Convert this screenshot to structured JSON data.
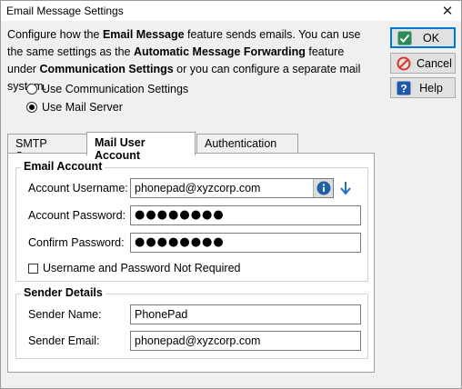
{
  "window": {
    "title": "Email Message Settings"
  },
  "intro": {
    "t1": "Configure how the ",
    "b1": "Email Message",
    "t2": " feature sends emails.  You can use the same settings as the ",
    "b2": "Automatic Message Forwarding",
    "t3": " feature under ",
    "b3": "Communication Settings",
    "t4": " or you can configure a separate mail system."
  },
  "buttons": {
    "ok": "OK",
    "cancel": "Cancel",
    "help": "Help"
  },
  "mode": {
    "options": [
      "Use Communication Settings",
      "Use Mail Server"
    ],
    "selected": "Use Mail Server"
  },
  "tabs": [
    "SMTP Server",
    "Mail User Account",
    "Authentication"
  ],
  "active_tab": "Mail User Account",
  "email_account": {
    "title": "Email Account",
    "username_label": "Account Username:",
    "username_value": "phonepad@xyzcorp.com",
    "password_label": "Account Password:",
    "password_value": "●●●●●●●●",
    "confirm_label": "Confirm Password:",
    "confirm_value": "●●●●●●●●",
    "not_required_label": "Username and Password Not Required",
    "not_required_checked": false
  },
  "sender": {
    "title": "Sender Details",
    "name_label": "Sender Name:",
    "name_value": "PhonePad",
    "email_label": "Sender Email:",
    "email_value": "phonepad@xyzcorp.com"
  },
  "colors": {
    "accent": "#0078d7",
    "ok_green": "#2e8b57",
    "cancel_red": "#d9342b",
    "help_blue": "#1e5aa8",
    "info_blue": "#1f5fa8"
  },
  "icons": {
    "ok": "check-icon",
    "cancel": "no-entry-icon",
    "help": "question-icon",
    "info": "info-icon",
    "arrow": "down-arrow-icon",
    "close": "close-icon"
  }
}
